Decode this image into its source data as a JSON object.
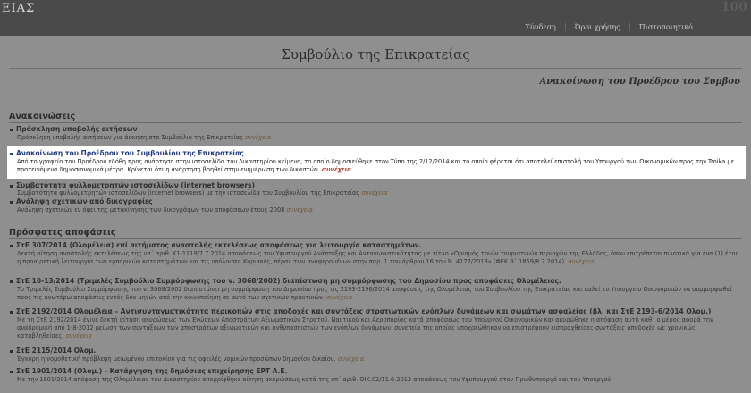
{
  "header": {
    "brand": "ΕΙΑΣ",
    "corner_logo": "100",
    "nav": [
      {
        "label": "Σύνδεση"
      },
      {
        "label": "Όροι χρήσης"
      },
      {
        "label": "Πιστοποιητικό"
      }
    ]
  },
  "page_title": "Συμβούλιο της Επικρατείας",
  "announcement_heading": "Ανακοίνωση του Προέδρου του Συμβου",
  "announcements": {
    "title": "Ανακοινώσεις",
    "more_label": "συνέχεια",
    "items": [
      {
        "title": "Πρόσκληση υποβολής αιτήσεων",
        "text": "Πρόσκληση υποβολής αιτήσεων για άσκηση στο Συμβούλιο της Επικρατείας"
      },
      {
        "title": "Ανακοίνωση του Προέδρου του Συμβουλίου της Επικρατείας",
        "text": "Από το γραφείο του Προέδρου εδόθη προς ανάρτηση στην ιστοσελίδα του Δικαστηρίου κείμενο, το οποίο δημοσιεύθηκε στον Τύπο της 2/12/2014 και το οποίο φέρεται ότι αποτελεί επιστολή του Υπουργού των Οικονομικών προς την Troika με προτεινόμενα δημοσιονομικά μέτρα. Κρίνεται ότι η ανάρτηση βοηθεί στην ενημέρωση των δικαστών."
      },
      {
        "title": "Συμβατότητα φυλλομετρητών ιστοσελίδων (internet browsers)",
        "text": "Συμβατότητα φυλλομετρητών ιστοσελίδων (internet browsers) με την ιστοσελίδα του Συμβουλίου της Επικρατείας"
      },
      {
        "title": "Ανάληψη σχετικών από δικογραφίες",
        "text": "Ανάληψη σχετικών εν όψει της μετακίνησης των δικογράφων των αποφάσεων έτους 2008"
      }
    ]
  },
  "recent": {
    "title": "Πρόσφατες αποφάσεις",
    "more_label": "συνέχεια",
    "items": [
      {
        "title": "ΣτΕ 307/2014 (Ολομέλεια) επί αιτήματος αναστολής εκτελέσεως αποφάσεως για λειτουργία καταστημάτων.",
        "text": "Δεκτή αίτηση αναστολής εκτελέσεως της υπ΄ αριθ. Κ1-1119/7.7.2014 αποφάσεως του Υφυπουργού Ανάπτυξης και Ανταγωνιστικότητας με τίτλο «Ορισμός τριών τουριστικών περιοχών της Ελλάδος, όπου επιτρέπεται πιλοτικά για ένα (1) έτος η προαιρετική λειτουργία των εμπορικών καταστημάτων και τις υπόλοιπες Κυριακές, πέραν των αναφερομένων στην παρ. 1 του άρθρου 16 του Ν. 4177/2013» (ΦΕΚ Β΄ 1859/8.7.2014)."
      },
      {
        "title": "ΣτΕ 10-13/2014 (Τριμελές Συμβούλιο Συμμόρφωσης του ν. 3068/2002) διαπίστωση μη συμμόρφωσης του Δημοσίου προς αποφάσεις Ολομέλειας.",
        "text": "Το Τριμελές Συμβούλιο Συμμόρφωσης του ν. 3068/2002 διαπιστώνει μη συμμόρφωση του Δημοσίου προς τις 2193-2196/2014 αποφάσεις της Ολομέλειας του Συμβουλίου της Επικρατείας και καλεί το Υπουργείο Οικονομικών να συμμορφωθεί προς τις ανωτέρω αποφάσεις εντός δύο μηνών από την κοινοποίηση σε αυτό των σχετικών πρακτικών."
      },
      {
        "title": "ΣτΕ 2192/2014 Ολομέλεια – Αντισυνταγματικότητα περικοπών στις αποδοχές και συντάξεις στρατιωτικών ενόπλων δυνάμεων και σωμάτων ασφαλείας (βλ. και ΣτΕ 2193-6/2014 Ολομ.)",
        "text": "Με τη ΣτΕ 2192/2014 έγινε δεκτή αίτηση ακυρώσεως των Ενώσεων Αποστράτων Αξιωματικών Στρατού, Ναυτικού και Αεροπορίας κατά αποφάσεως του Υπουργού Οικονομικών και ακυρώθηκε η απόφαση αυτή καθ΄ ο μέρος αφορά την αναδρομική από 1-8-2012 μείωση των συντάξεων των αποστράτων αξιωματικών και ανθυπασπιστών των ενόπλων δυνάμεων, συνεπεία της οποίας υποχρεώθηκαν να επιστρέψουν εισπραχθείσες συντάξεις αποδοχές ως χρονικώς καταβληθείσες."
      },
      {
        "title": "ΣτΕ 2115/2014 Ολομ.",
        "text": "Έγκυρη η νομοθετική πρόβλεψη μειωμένου επιτοκίου για τις οφειλές νομικών προσώπων δημοσίου δικαίου."
      },
      {
        "title": "ΣτΕ 1901/2014 (Ολομ.) - Κατάργηση της δημόσιας επιχείρησης ΕΡΤ Α.Ε.",
        "text": "Με την 1901/2014 απόφαση της Ολομέλειας του Δικαστηρίου απορρίφθηκε αίτηση ακυρώσεως κατά της υπ΄ αριθ. ΟΙΚ.02/11.6.2013 αποφάσεως του Υφυπουργού στον Πρωθυπουργό και του Υπουργού"
      }
    ]
  }
}
